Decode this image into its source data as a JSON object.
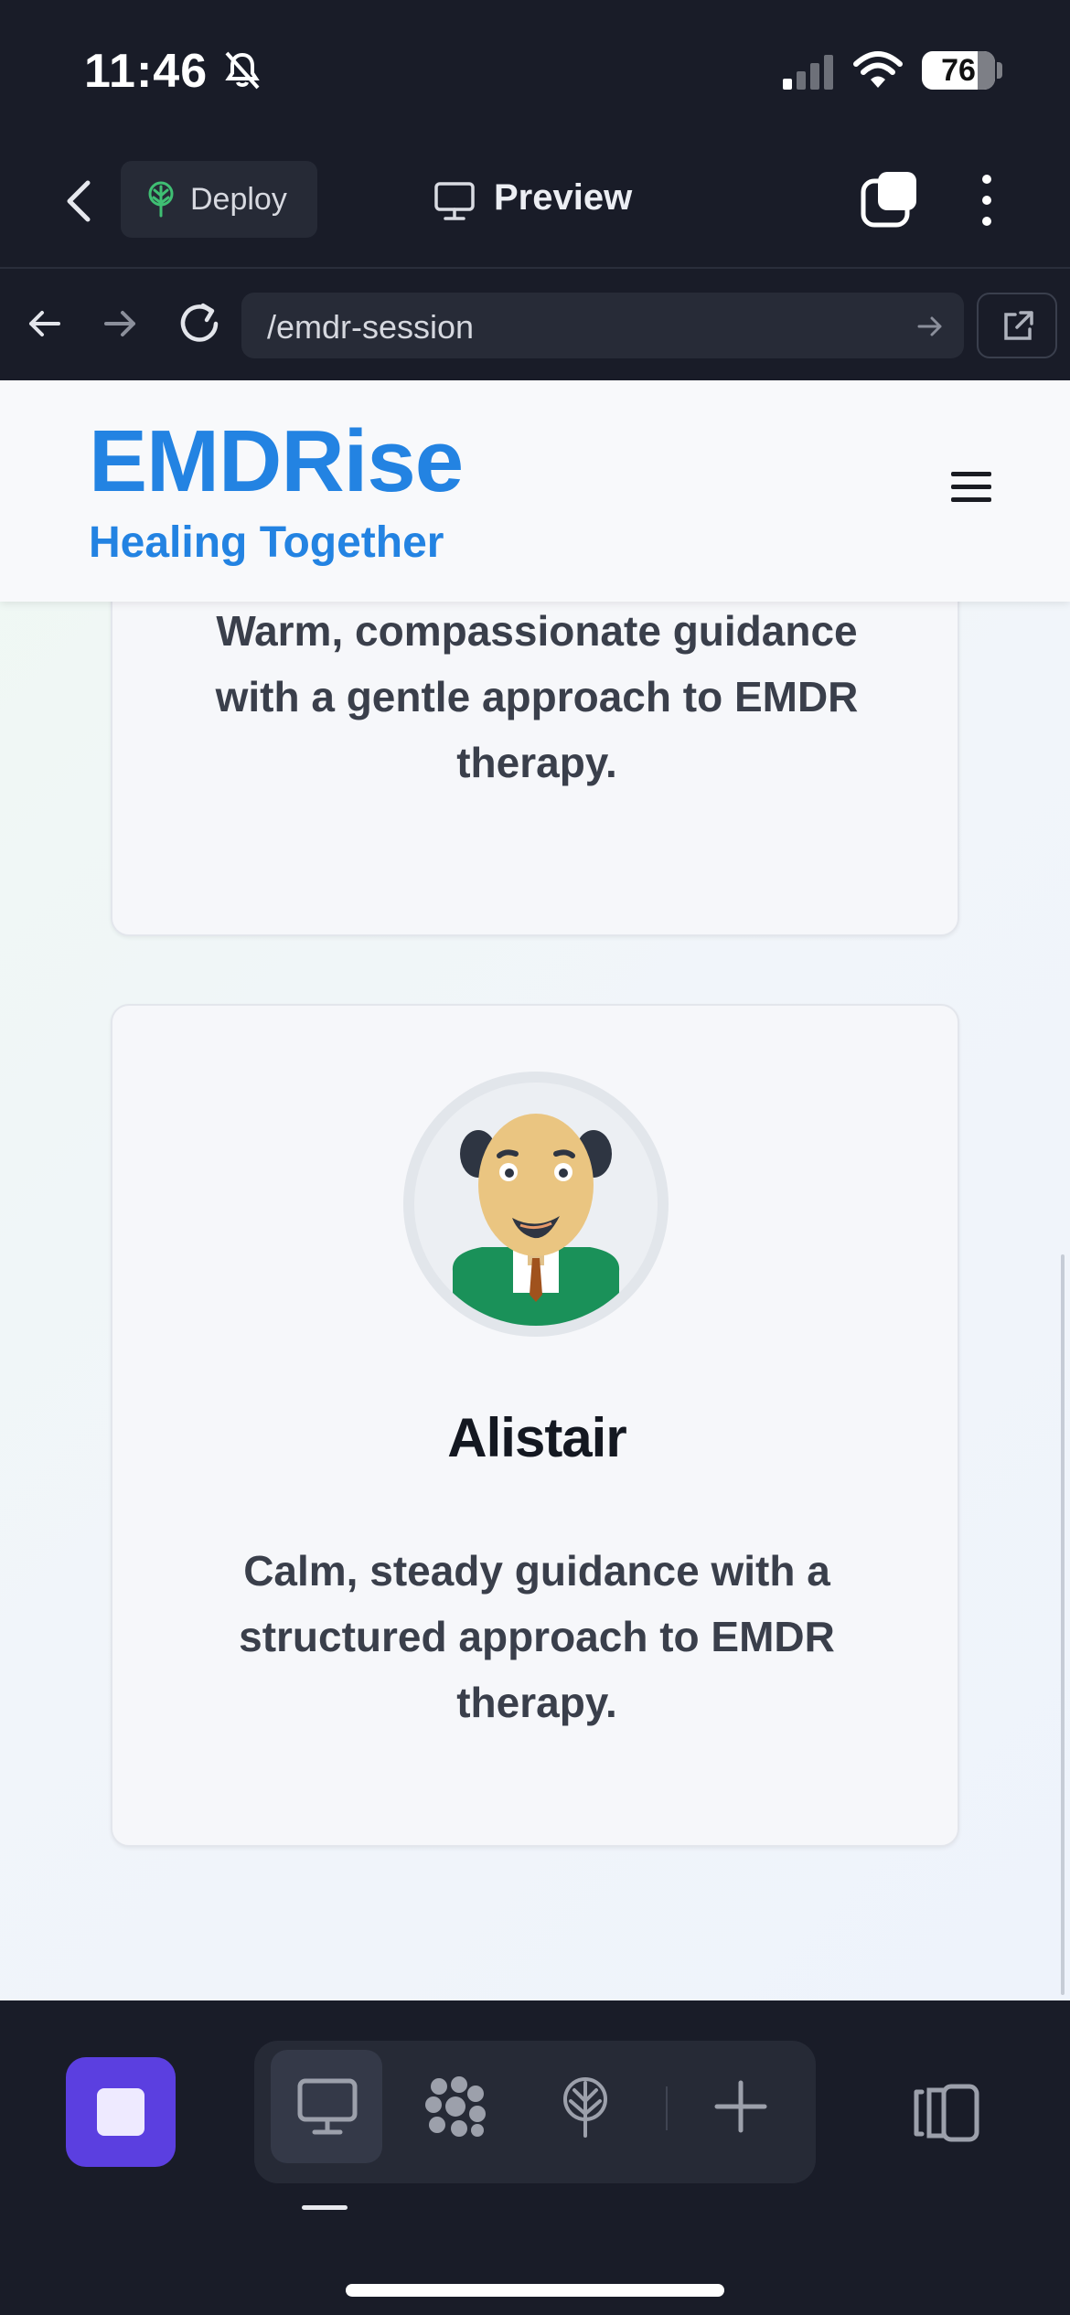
{
  "status_bar": {
    "time": "11:46",
    "battery": "76",
    "icons": [
      "bell-slash-icon",
      "signal-icon",
      "wifi-icon",
      "battery-icon"
    ]
  },
  "toolbar": {
    "deploy_label": "Deploy",
    "preview_label": "Preview",
    "icons": [
      "back-chevron-icon",
      "deploy-tree-icon",
      "monitor-icon",
      "tabs-icon",
      "more-vertical-icon"
    ]
  },
  "url_bar": {
    "url": "/emdr-session",
    "icons": [
      "back-arrow-icon",
      "forward-arrow-icon",
      "reload-icon",
      "go-arrow-icon",
      "external-link-icon"
    ]
  },
  "site": {
    "logo": "EMDRise",
    "tagline": "Healing Together",
    "cards": [
      {
        "name": "",
        "description": "Warm, compassionate guidance with a gentle approach to EMDR therapy."
      },
      {
        "name": "Alistair",
        "description": "Calm, steady guidance with a structured approach to EMDR therapy."
      }
    ]
  },
  "bottom_bar": {
    "icons": [
      "stop-icon",
      "desktop-icon",
      "agents-icon",
      "deploy-icon",
      "plus-icon",
      "side-panel-icon"
    ]
  },
  "colors": {
    "brand": "#2383e2",
    "chrome": "#191c28",
    "stop": "#5b3fe0",
    "avatar_shirt": "#1a9159"
  }
}
